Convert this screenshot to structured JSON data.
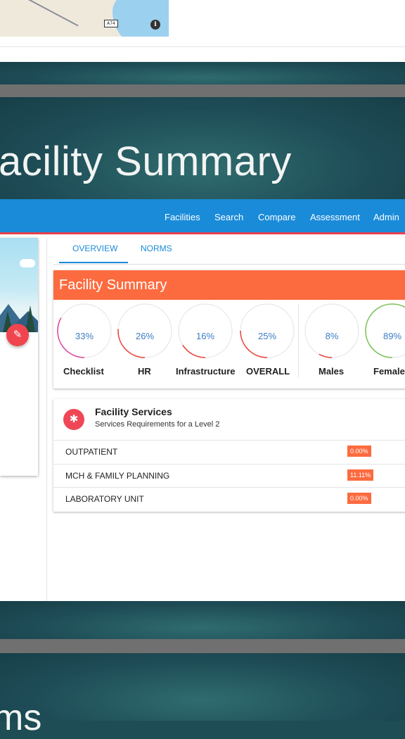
{
  "map": {
    "road_shield": "A74",
    "info_icon": "info-icon"
  },
  "heading": "acility Summary",
  "bottom_heading": "ms",
  "nav": {
    "items": [
      {
        "label": "Facilities"
      },
      {
        "label": "Search"
      },
      {
        "label": "Compare"
      },
      {
        "label": "Assessment"
      },
      {
        "label": "Admin"
      }
    ]
  },
  "tabs": [
    {
      "label": "OVERVIEW",
      "active": true
    },
    {
      "label": "NORMS",
      "active": false
    }
  ],
  "summary": {
    "title": "Facility Summary",
    "gauges": [
      {
        "pct": "33%",
        "value": 33,
        "label": "Checklist",
        "color": "#e0479b"
      },
      {
        "pct": "26%",
        "value": 26,
        "label": "HR",
        "color": "#e8473f"
      },
      {
        "pct": "16%",
        "value": 16,
        "label": "Infrastructure",
        "color": "#e8473f"
      },
      {
        "pct": "25%",
        "value": 25,
        "label": "OVERALL",
        "color": "#e8473f"
      },
      {
        "pct": "8%",
        "value": 8,
        "label": "Males",
        "color": "#e8473f"
      },
      {
        "pct": "89%",
        "value": 89,
        "label": "Female",
        "color": "#7cc25a"
      }
    ]
  },
  "services": {
    "title": "Facility Services",
    "subtitle": "Services Requirements for a Level 2",
    "rows": [
      {
        "name": "OUTPATIENT",
        "badge": "0.00%"
      },
      {
        "name": "MCH & FAMILY PLANNING",
        "badge": "11.11%"
      },
      {
        "name": "LABORATORY UNIT",
        "badge": "0.00%"
      }
    ]
  },
  "colors": {
    "navbar": "#1a8bd9",
    "accent_orange": "#fc6b3f",
    "fab_red": "#f0454f"
  }
}
